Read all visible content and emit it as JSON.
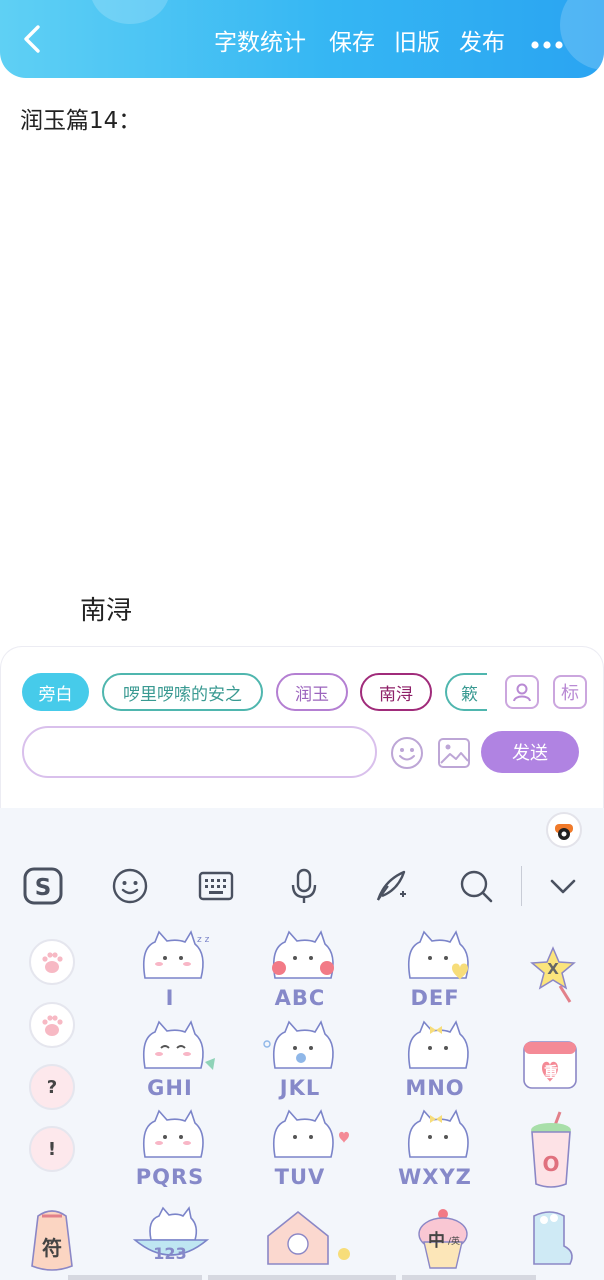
{
  "topbar": {
    "word_count": "字数统计",
    "save": "保存",
    "old_version": "旧版",
    "publish": "发布"
  },
  "editor": {
    "title": "润玉篇14：",
    "line_name": "南浔"
  },
  "chips": [
    {
      "label": "旁白"
    },
    {
      "label": "啰里啰嗦的安之"
    },
    {
      "label": "润玉"
    },
    {
      "label": "南浔"
    },
    {
      "label": "簌"
    }
  ],
  "panel": {
    "tag_button": "标",
    "send_label": "发送",
    "input_value": ""
  },
  "keyboard": {
    "paws": [
      {
        "label": ""
      },
      {
        "label": ""
      },
      {
        "label": "?"
      },
      {
        "label": "!"
      }
    ],
    "keys": [
      {
        "label": "I"
      },
      {
        "label": "ABC"
      },
      {
        "label": "DEF"
      },
      {
        "label": "GHI"
      },
      {
        "label": "JKL"
      },
      {
        "label": "MNO"
      },
      {
        "label": "PQRS"
      },
      {
        "label": "TUV"
      },
      {
        "label": "WXYZ"
      },
      {
        "label": "123"
      }
    ],
    "side": {
      "x_key": "X",
      "heavy_key": "重",
      "o_key": "O",
      "symbol_key": "符",
      "chinese_key": "中",
      "chinese_sub": "/英"
    }
  },
  "colors": {
    "topbar_start": "#5fd0f4",
    "topbar_end": "#2aa4f2",
    "send_button": "#b083e2",
    "active_chip": "#46cbea",
    "keyboard_bg": "#f3f6fb",
    "key_label": "#8689c9"
  }
}
